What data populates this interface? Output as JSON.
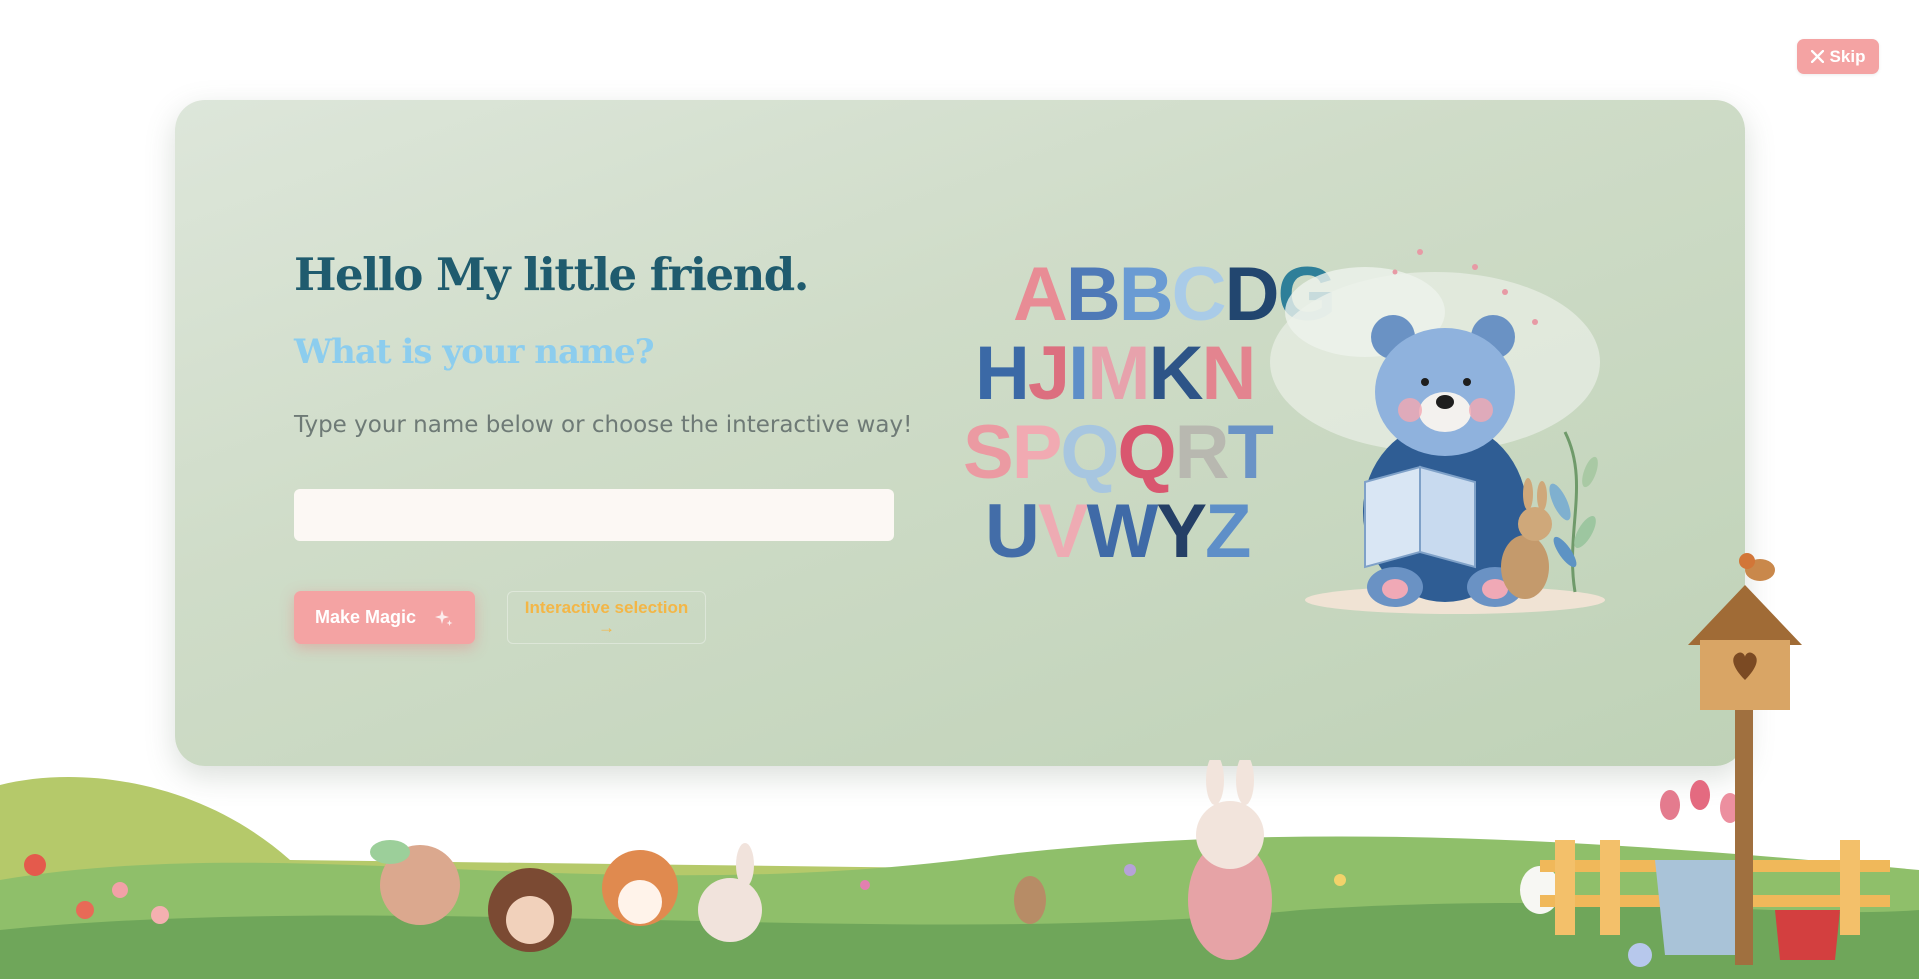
{
  "skip": {
    "label": "Skip",
    "icon": "close-icon"
  },
  "welcome": {
    "title": "Hello My little friend.",
    "subtitle": "What is your name?",
    "hint": "Type your name below or choose the interactive way!",
    "name_input": {
      "value": "",
      "placeholder": ""
    }
  },
  "actions": {
    "magic_label": "Make Magic",
    "magic_icon": "sparkles-icon",
    "interactive_label": "Interactive selection →"
  },
  "illustration": {
    "alphabet_rows": [
      [
        {
          "ch": "A",
          "color": "#e88c95"
        },
        {
          "ch": "B",
          "color": "#4e79b7"
        },
        {
          "ch": "B",
          "color": "#6a9bd3"
        },
        {
          "ch": "C",
          "color": "#a9cbe8"
        },
        {
          "ch": "D",
          "color": "#22466f"
        },
        {
          "ch": "G",
          "color": "#2e7f99"
        }
      ],
      [
        {
          "ch": "H",
          "color": "#3b69a6"
        },
        {
          "ch": "J",
          "color": "#dc6f7f"
        },
        {
          "ch": "I",
          "color": "#5e8ec8"
        },
        {
          "ch": "M",
          "color": "#e7a2ac"
        },
        {
          "ch": "K",
          "color": "#2d5487"
        },
        {
          "ch": "N",
          "color": "#e3848f"
        }
      ],
      [
        {
          "ch": "S",
          "color": "#eb9aa2"
        },
        {
          "ch": "P",
          "color": "#f1aab2"
        },
        {
          "ch": "Q",
          "color": "#a7c6e0"
        },
        {
          "ch": "Q",
          "color": "#d9566f"
        },
        {
          "ch": "R",
          "color": "#b8b8b0"
        },
        {
          "ch": "T",
          "color": "#6a93c6"
        }
      ],
      [
        {
          "ch": "U",
          "color": "#436da8"
        },
        {
          "ch": "V",
          "color": "#eeabb3"
        },
        {
          "ch": "W",
          "color": "#3f6aa7"
        },
        {
          "ch": "Y",
          "color": "#243f66"
        },
        {
          "ch": "Z",
          "color": "#5e8fc8"
        }
      ]
    ]
  },
  "colors": {
    "primary_pink": "#f4a3a3",
    "title_teal": "#1f5b6e",
    "subtitle_blue": "#8ccdee",
    "accent_orange": "#f3b646"
  }
}
